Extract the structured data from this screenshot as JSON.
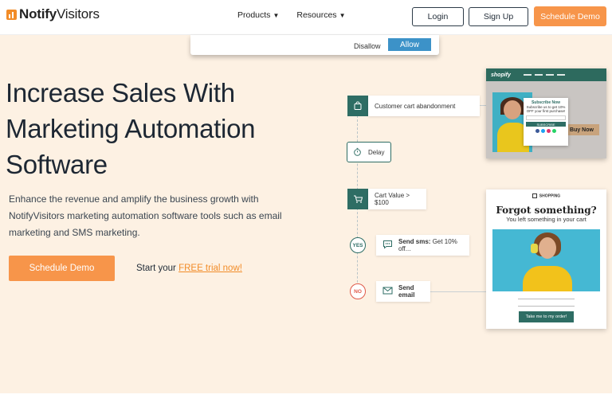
{
  "header": {
    "logo_prefix": "Notify",
    "logo_suffix": "Visitors",
    "nav": [
      {
        "label": "Products"
      },
      {
        "label": "Resources"
      }
    ],
    "login_label": "Login",
    "signup_label": "Sign Up",
    "schedule_label": "Schedule Demo"
  },
  "consent": {
    "disallow_label": "Disallow",
    "allow_label": "Allow"
  },
  "hero": {
    "title_line1": "Increase Sales With",
    "title_line2": "Marketing Automation",
    "title_line3": "Software",
    "subtitle": "Enhance the revenue and amplify the business growth with NotifyVisitors marketing automation software tools such as email marketing and SMS marketing.",
    "cta_label": "Schedule Demo",
    "trial_prefix": "Start your ",
    "trial_link": "FREE trial now!"
  },
  "flow": {
    "step1": "Customer cart abandonment",
    "step2": "Delay",
    "step3": "Cart Value > $100",
    "yes_label": "YES",
    "no_label": "NO",
    "sms_bold": "Send sms:",
    "sms_text": " Get 10% off...",
    "email_label": "Send email"
  },
  "shop_mock": {
    "brand": "shopify",
    "buy_now": "Buy Now",
    "subscribe_title": "Subscribe Now",
    "subscribe_text": "Subscribe us to get 10% OFF your first purchase!",
    "subscribe_button": "SUBSCRIBE"
  },
  "email_mock": {
    "brand": "SHOPPING",
    "headline": "Forgot something?",
    "subline": "You left something in your cart",
    "cta": "Take me to my order!"
  },
  "colors": {
    "accent": "#f7954a",
    "hero_bg": "#fdf1e3",
    "teal": "#2e6d64",
    "allow_blue": "#3c92c8"
  }
}
